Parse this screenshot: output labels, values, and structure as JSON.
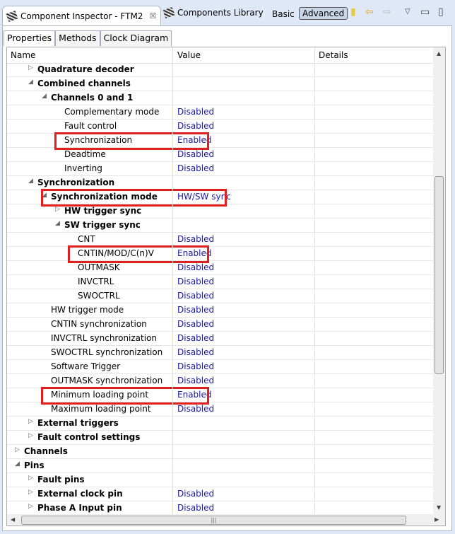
{
  "tabs": [
    {
      "label": "Component Inspector - FTM2",
      "active": true
    },
    {
      "label": "Components Library"
    }
  ],
  "toolbar": {
    "basic": "Basic",
    "advanced": "Advanced"
  },
  "subtabs": [
    "Properties",
    "Methods",
    "Clock Diagram"
  ],
  "columns": [
    "Name",
    "Value",
    "Details"
  ],
  "rows": [
    {
      "name": "Quadrature decoder",
      "indent": 2,
      "bold": true,
      "toggle": "collapsed",
      "value": ""
    },
    {
      "name": "Combined channels",
      "indent": 2,
      "bold": true,
      "toggle": "expanded",
      "value": ""
    },
    {
      "name": "Channels 0 and 1",
      "indent": 3,
      "bold": true,
      "toggle": "expanded",
      "value": ""
    },
    {
      "name": "Complementary mode",
      "indent": 4,
      "value": "Disabled"
    },
    {
      "name": "Fault control",
      "indent": 4,
      "value": "Disabled"
    },
    {
      "name": "Synchronization",
      "indent": 4,
      "value": "Enabled",
      "highlight": true
    },
    {
      "name": "Deadtime",
      "indent": 4,
      "value": "Disabled"
    },
    {
      "name": "Inverting",
      "indent": 4,
      "value": "Disabled"
    },
    {
      "name": "Synchronization",
      "indent": 2,
      "bold": true,
      "toggle": "expanded",
      "value": ""
    },
    {
      "name": "Synchronization mode",
      "indent": 3,
      "bold": true,
      "toggle": "expanded",
      "value": "HW/SW sync",
      "highlight": true
    },
    {
      "name": "HW trigger sync",
      "indent": 4,
      "bold": true,
      "toggle": "collapsed",
      "value": ""
    },
    {
      "name": "SW trigger sync",
      "indent": 4,
      "bold": true,
      "toggle": "expanded",
      "value": ""
    },
    {
      "name": "CNT",
      "indent": 5,
      "value": "Disabled"
    },
    {
      "name": "CNTIN/MOD/C(n)V",
      "indent": 5,
      "value": "Enabled",
      "highlight": true
    },
    {
      "name": "OUTMASK",
      "indent": 5,
      "value": "Disabled"
    },
    {
      "name": "INVCTRL",
      "indent": 5,
      "value": "Disabled"
    },
    {
      "name": "SWOCTRL",
      "indent": 5,
      "value": "Disabled"
    },
    {
      "name": "HW trigger mode",
      "indent": 3,
      "value": "Disabled"
    },
    {
      "name": "CNTIN synchronization",
      "indent": 3,
      "value": "Disabled"
    },
    {
      "name": "INVCTRL synchronization",
      "indent": 3,
      "value": "Disabled"
    },
    {
      "name": "SWOCTRL synchronization",
      "indent": 3,
      "value": "Disabled"
    },
    {
      "name": "Software Trigger",
      "indent": 3,
      "value": "Disabled"
    },
    {
      "name": "OUTMASK synchronization",
      "indent": 3,
      "value": "Disabled"
    },
    {
      "name": "Minimum loading point",
      "indent": 3,
      "value": "Enabled",
      "highlight": true
    },
    {
      "name": "Maximum loading point",
      "indent": 3,
      "value": "Disabled"
    },
    {
      "name": "External triggers",
      "indent": 2,
      "bold": true,
      "toggle": "collapsed",
      "value": ""
    },
    {
      "name": "Fault control settings",
      "indent": 2,
      "bold": true,
      "toggle": "collapsed",
      "value": ""
    },
    {
      "name": "Channels",
      "indent": 1,
      "bold": true,
      "toggle": "collapsed",
      "value": ""
    },
    {
      "name": "Pins",
      "indent": 1,
      "bold": true,
      "toggle": "expanded",
      "value": ""
    },
    {
      "name": "Fault pins",
      "indent": 2,
      "bold": true,
      "toggle": "collapsed",
      "value": ""
    },
    {
      "name": "External clock pin",
      "indent": 2,
      "bold": true,
      "toggle": "collapsed",
      "value": "Disabled"
    },
    {
      "name": "Phase A Input pin",
      "indent": 2,
      "bold": true,
      "toggle": "collapsed",
      "value": "Disabled"
    }
  ],
  "colors": {
    "highlight": "#e0201f",
    "value_text": "#1a1aa6"
  }
}
